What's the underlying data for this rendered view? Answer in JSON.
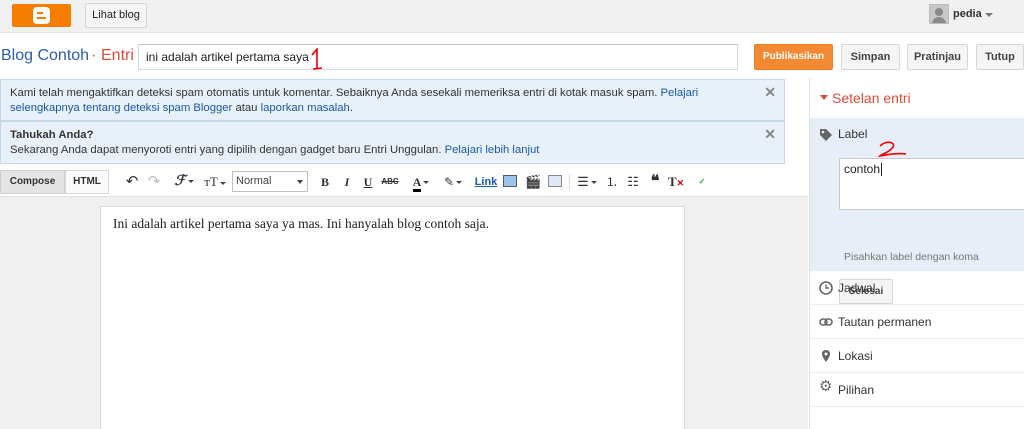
{
  "topbar": {
    "view_blog": "Lihat blog",
    "username": "pedia"
  },
  "title_row": {
    "blog_name": "Blog Contoh",
    "separator": "·",
    "entry_label": "Entri",
    "post_title": "ini adalah artikel pertama saya",
    "annotation": "1",
    "publish": "Publikasikan",
    "save": "Simpan",
    "preview": "Pratinjau",
    "close": "Tutup"
  },
  "notices": [
    {
      "text_before": "Kami telah mengaktifkan deteksi spam otomatis untuk komentar. Sebaiknya Anda sesekali memeriksa entri di kotak masuk spam. ",
      "link1": "Pelajari selengkapnya tentang deteksi spam Blogger",
      "text_mid": " atau ",
      "link2": "laporkan masalah",
      "text_after": "."
    },
    {
      "title": "Tahukah Anda?",
      "text": "Sekarang Anda dapat menyoroti entri yang dipilih dengan gadget baru Entri Unggulan. ",
      "link": "Pelajari lebih lanjut"
    }
  ],
  "toolbar": {
    "compose": "Compose",
    "html": "HTML",
    "font_size_value": "Normal",
    "bold": "B",
    "italic": "I",
    "underline": "U",
    "strike": "ABC",
    "link": "Link"
  },
  "editor": {
    "body": "Ini adalah artikel pertama saya ya mas. Ini hanyalah blog contoh saja."
  },
  "settings": {
    "title": "Setelan entri",
    "label_section": {
      "title": "Label",
      "value": "contoh",
      "annotation": "2",
      "hint": "Pisahkan label dengan koma",
      "done": "Selesai"
    },
    "items": [
      {
        "label": "Jadwal",
        "icon": "clock-icon"
      },
      {
        "label": "Tautan permanen",
        "icon": "link-icon"
      },
      {
        "label": "Lokasi",
        "icon": "location-pin-icon"
      },
      {
        "label": "Pilihan",
        "icon": "gear-icon"
      }
    ]
  },
  "colors": {
    "accent_orange": "#f58932",
    "title_blue": "#2a5db0",
    "entry_red": "#dd4b39",
    "notice_bg": "#e8f0fa"
  }
}
